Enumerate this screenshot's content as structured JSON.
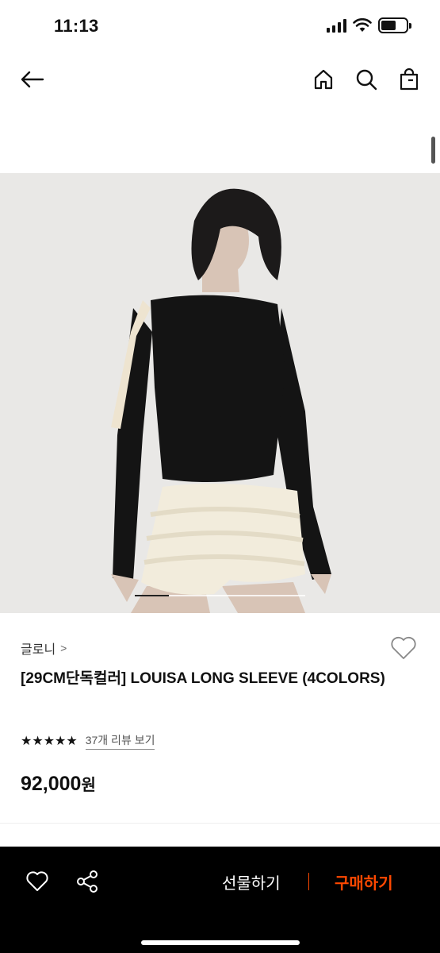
{
  "status_bar": {
    "time": "11:13",
    "battery_level": 0.6
  },
  "nav": {
    "back_icon": "arrow-left-icon",
    "home_icon": "home-icon",
    "search_icon": "search-icon",
    "bag_icon": "shopping-bag-icon"
  },
  "product": {
    "image_alt": "model wearing black long sleeve with cream ruffle shorts",
    "carousel_position": 0.2,
    "brand": "글로니",
    "brand_arrow": ">",
    "title": "[29CM단독컬러] LOUISA LONG SLEEVE (4COLORS)",
    "stars": "★★★★★",
    "rating": 5,
    "review_link": "37개 리뷰 보기",
    "price": "92,000",
    "price_unit": "원"
  },
  "bottom_bar": {
    "wishlist_icon": "heart-outline-icon",
    "share_icon": "share-icon",
    "gift_label": "선물하기",
    "buy_label": "구매하기"
  },
  "colors": {
    "accent": "#ff4800",
    "bottom_bar_bg": "#000000",
    "image_bg": "#e9e8e6"
  }
}
